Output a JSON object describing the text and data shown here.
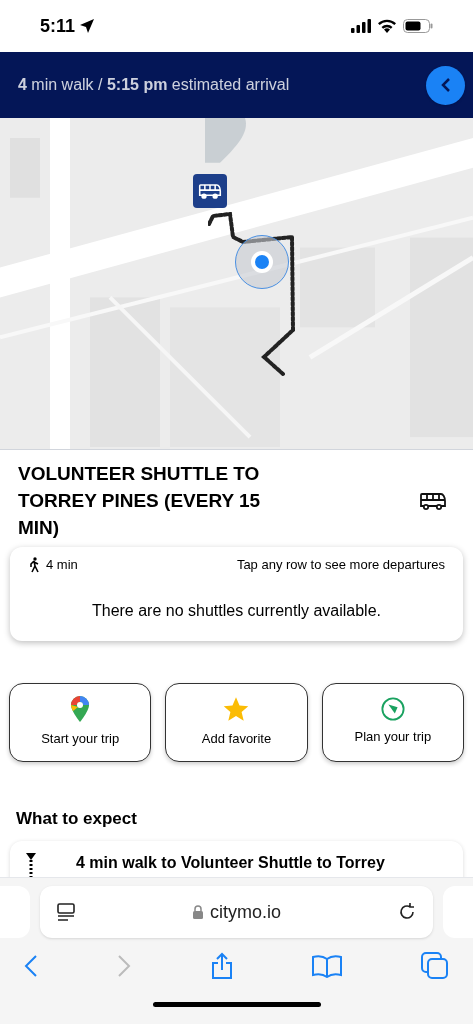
{
  "status_bar": {
    "time": "5:11"
  },
  "header": {
    "summary": "**4** min walk / **5:15 pm** estimated arrival"
  },
  "route": {
    "title": "VOLUNTEER SHUTTLE TO TORREY PINES (EVERY 15 MIN)",
    "walk_time": "4 min",
    "hint": "Tap any row to see more departures",
    "message": "There are no shuttles currently available."
  },
  "actions": [
    {
      "label": "Start your trip",
      "kind": "maps"
    },
    {
      "label": "Add favorite",
      "kind": "favorite"
    },
    {
      "label": "Plan your trip",
      "kind": "compass"
    }
  ],
  "expect": {
    "heading": "What to expect",
    "steps": [
      {
        "text": "4 min walk to Volunteer Shuttle to Torrey"
      }
    ]
  },
  "browser": {
    "url": "citymo.io",
    "forward_disabled": true
  }
}
